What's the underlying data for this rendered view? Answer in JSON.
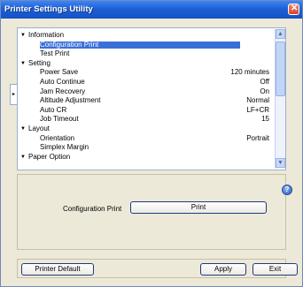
{
  "window": {
    "title": "Printer Settings Utility"
  },
  "tree": {
    "items": [
      {
        "label": "Information",
        "value": "",
        "level": 0,
        "expanded": true
      },
      {
        "label": "Configuration Print",
        "value": "",
        "level": 1,
        "selected": true
      },
      {
        "label": "Test Print",
        "value": "",
        "level": 1
      },
      {
        "label": "Setting",
        "value": "",
        "level": 0,
        "expanded": true
      },
      {
        "label": "Power Save",
        "value": "120 minutes",
        "level": 1
      },
      {
        "label": "Auto Continue",
        "value": "Off",
        "level": 1
      },
      {
        "label": "Jam Recovery",
        "value": "On",
        "level": 1
      },
      {
        "label": "Altitude Adjustment",
        "value": "Normal",
        "level": 1
      },
      {
        "label": "Auto CR",
        "value": "LF+CR",
        "level": 1
      },
      {
        "label": "Job Timeout",
        "value": "15",
        "level": 1
      },
      {
        "label": "Layout",
        "value": "",
        "level": 0,
        "expanded": true
      },
      {
        "label": "Orientation",
        "value": "Portrait",
        "level": 1
      },
      {
        "label": "Simplex Margin",
        "value": "",
        "level": 1
      },
      {
        "label": "Paper Option",
        "value": "",
        "level": 0,
        "expanded": true
      }
    ]
  },
  "detail": {
    "field_label": "Configuration Print",
    "print_button": "Print"
  },
  "buttons": {
    "printer_default": "Printer Default",
    "apply": "Apply",
    "exit": "Exit"
  },
  "icons": {
    "close": "close-icon",
    "help": "help-icon",
    "expand": "expand-arrow-icon"
  },
  "colors": {
    "title_bar": "#1d5fd6",
    "selection": "#3a6fd8",
    "close_button": "#d9442a"
  }
}
